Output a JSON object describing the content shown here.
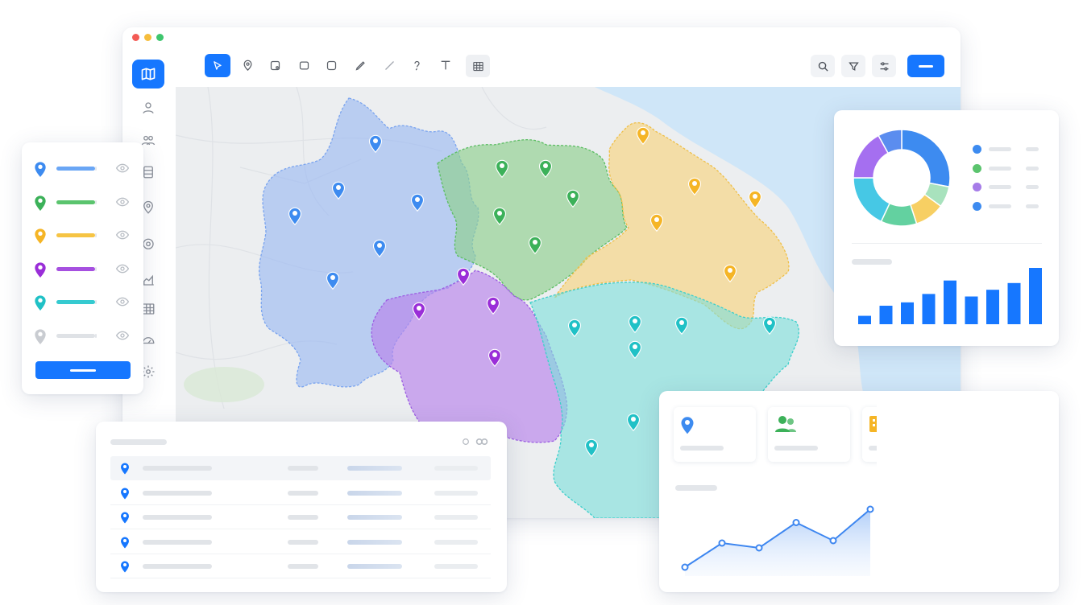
{
  "window": {
    "controls": [
      {
        "name": "close",
        "color": "#f35b55"
      },
      {
        "name": "minimize",
        "color": "#f6bd3c"
      },
      {
        "name": "maximize",
        "color": "#3ec66e"
      }
    ]
  },
  "sidebar": {
    "items": [
      {
        "icon": "map-icon",
        "active": true
      },
      {
        "icon": "user-icon",
        "active": false
      },
      {
        "icon": "users-icon",
        "active": false
      },
      {
        "icon": "database-icon",
        "active": false
      },
      {
        "icon": "location-pin-icon",
        "active": false
      },
      {
        "icon": "map-pin-icon",
        "active": false
      },
      {
        "icon": "area-chart-icon",
        "active": false
      },
      {
        "icon": "table-icon",
        "active": false
      },
      {
        "icon": "dashboard-icon",
        "active": false
      },
      {
        "icon": "settings-icon",
        "active": false
      }
    ]
  },
  "toolbar": {
    "tools": [
      "pointer-icon",
      "pin-icon",
      "polygon-icon",
      "rectangle-icon",
      "square-icon",
      "pencil-icon",
      "line-icon",
      "lasso-icon",
      "text-icon",
      "grid-icon"
    ],
    "active_tool": "pointer-icon",
    "right_tools": [
      "search-icon",
      "filter-icon",
      "sliders-icon"
    ],
    "primary_button_label": ""
  },
  "map": {
    "regions": [
      {
        "name": "blue",
        "color": "#5b8def"
      },
      {
        "name": "green",
        "color": "#4cb85f"
      },
      {
        "name": "yellow",
        "color": "#f2b83a"
      },
      {
        "name": "purple",
        "color": "#9a4fe0"
      },
      {
        "name": "teal",
        "color": "#22c2c2"
      }
    ]
  },
  "layers_panel": {
    "layers": [
      {
        "color": "#3d8bf0",
        "bar": "#6aa6f5"
      },
      {
        "color": "#3cb159",
        "bar": "#5bc46e"
      },
      {
        "color": "#f5b526",
        "bar": "#f6c444"
      },
      {
        "color": "#9a2ed8",
        "bar": "#a650e0"
      },
      {
        "color": "#20c1c6",
        "bar": "#35cad0"
      },
      {
        "color": "#c9ccd1",
        "bar": "#dfe2e6"
      }
    ],
    "button_label": ""
  },
  "stats_panel": {
    "donut": [
      {
        "color": "#3d8bf0",
        "value": 28
      },
      {
        "color": "#a8e2bd",
        "value": 7
      },
      {
        "color": "#f7cf63",
        "value": 10
      },
      {
        "color": "#63d1a0",
        "value": 12
      },
      {
        "color": "#46c8e5",
        "value": 18
      },
      {
        "color": "#a56ff0",
        "value": 17
      },
      {
        "color": "#5b8def",
        "value": 8
      }
    ],
    "legend": [
      {
        "color": "#3d8bf0"
      },
      {
        "color": "#5bc46e"
      },
      {
        "color": "#a67ce8"
      },
      {
        "color": "#3d8bf0"
      }
    ],
    "bars": [
      10,
      22,
      26,
      36,
      52,
      33,
      41,
      49,
      67
    ]
  },
  "table_panel": {
    "rows": 5
  },
  "dashboard_panel": {
    "cards": [
      {
        "icon": "location-pin-icon",
        "color": "#3d8bf0"
      },
      {
        "icon": "users-icon",
        "color": "#3cb159"
      },
      {
        "icon": "building-icon",
        "color": "#f5b526"
      }
    ],
    "line_values": [
      10,
      30,
      26,
      47,
      32,
      58
    ]
  }
}
